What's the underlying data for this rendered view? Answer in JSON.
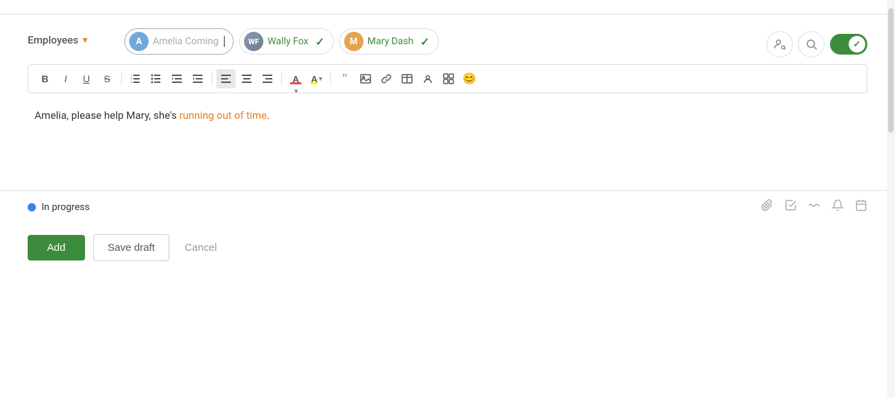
{
  "label": {
    "employees": "Employees",
    "dropdown_arrow": "▼"
  },
  "tags": [
    {
      "id": "amelia",
      "initial": "A",
      "avatar_type": "blue",
      "name": "Amelia Coming",
      "checked": false,
      "placeholder": true
    },
    {
      "id": "wally",
      "initial": "W",
      "avatar_type": "photo",
      "name": "Wally Fox",
      "checked": true
    },
    {
      "id": "mary",
      "initial": "M",
      "avatar_type": "orange",
      "name": "Mary Dash",
      "checked": true
    }
  ],
  "toolbar": {
    "buttons": [
      "B",
      "I",
      "U",
      "S",
      "ol",
      "ul",
      "outdent",
      "indent",
      "align-left",
      "align-center",
      "align-right",
      "font-color",
      "bg-color",
      "quote",
      "image",
      "link",
      "table",
      "person",
      "table2",
      "emoji"
    ]
  },
  "editor": {
    "text_plain": "Amelia, please help Mary, she's ",
    "text_highlight": "running out of time",
    "text_end": "."
  },
  "status": {
    "dot_color": "#3b82f6",
    "label": "In progress"
  },
  "actions": {
    "add_label": "Add",
    "save_draft_label": "Save draft",
    "cancel_label": "Cancel"
  },
  "icons": {
    "person_search": "👤",
    "search": "🔍",
    "toggle_check": "✓"
  }
}
